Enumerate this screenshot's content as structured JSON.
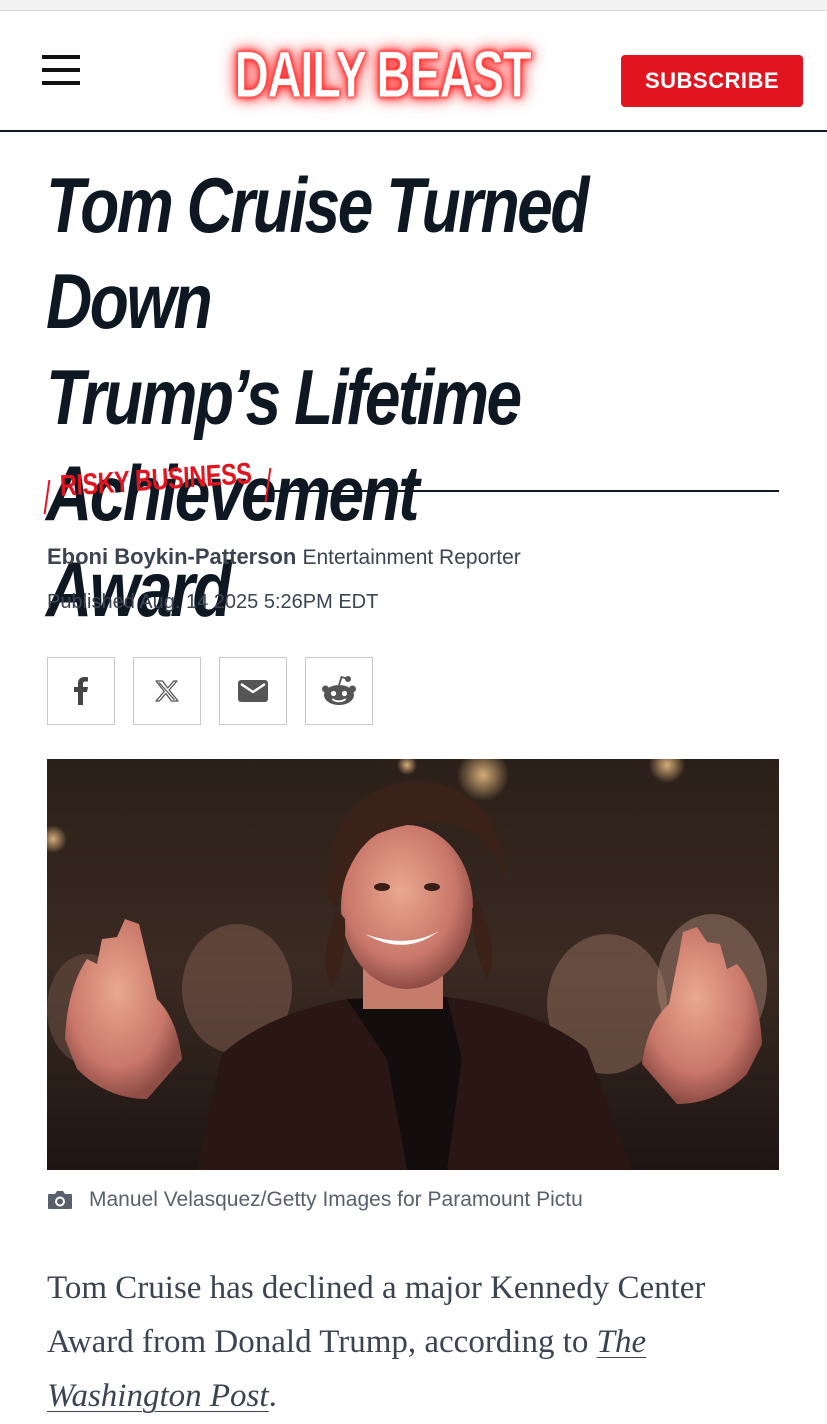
{
  "header": {
    "logo": "DAILY BEAST",
    "subscribe_label": "SUBSCRIBE"
  },
  "article": {
    "headline_lines": [
      "Tom Cruise Turned Down",
      "Trump’s Lifetime Achievement",
      "Award"
    ],
    "rubric": "RISKY BUSINESS",
    "author": "Eboni Boykin-Patterson",
    "author_role": "Entertainment Reporter",
    "published": "Published Aug. 14 2025 5:26PM EDT",
    "share": [
      {
        "name": "facebook",
        "icon": "facebook-icon"
      },
      {
        "name": "x",
        "icon": "x-icon"
      },
      {
        "name": "email",
        "icon": "mail-icon"
      },
      {
        "name": "reddit",
        "icon": "reddit-icon"
      }
    ],
    "photo_credit": "Manuel Velasquez/Getty Images for Paramount Pictu",
    "body_before_link": "Tom Cruise has declined a major Kennedy Center Award from Donald Trump, according to ",
    "body_link": "The Washington Post",
    "body_after_link": "."
  },
  "colors": {
    "brand_red": "#e2141f",
    "ink": "#0d1823",
    "text_gray": "#3b4450"
  }
}
